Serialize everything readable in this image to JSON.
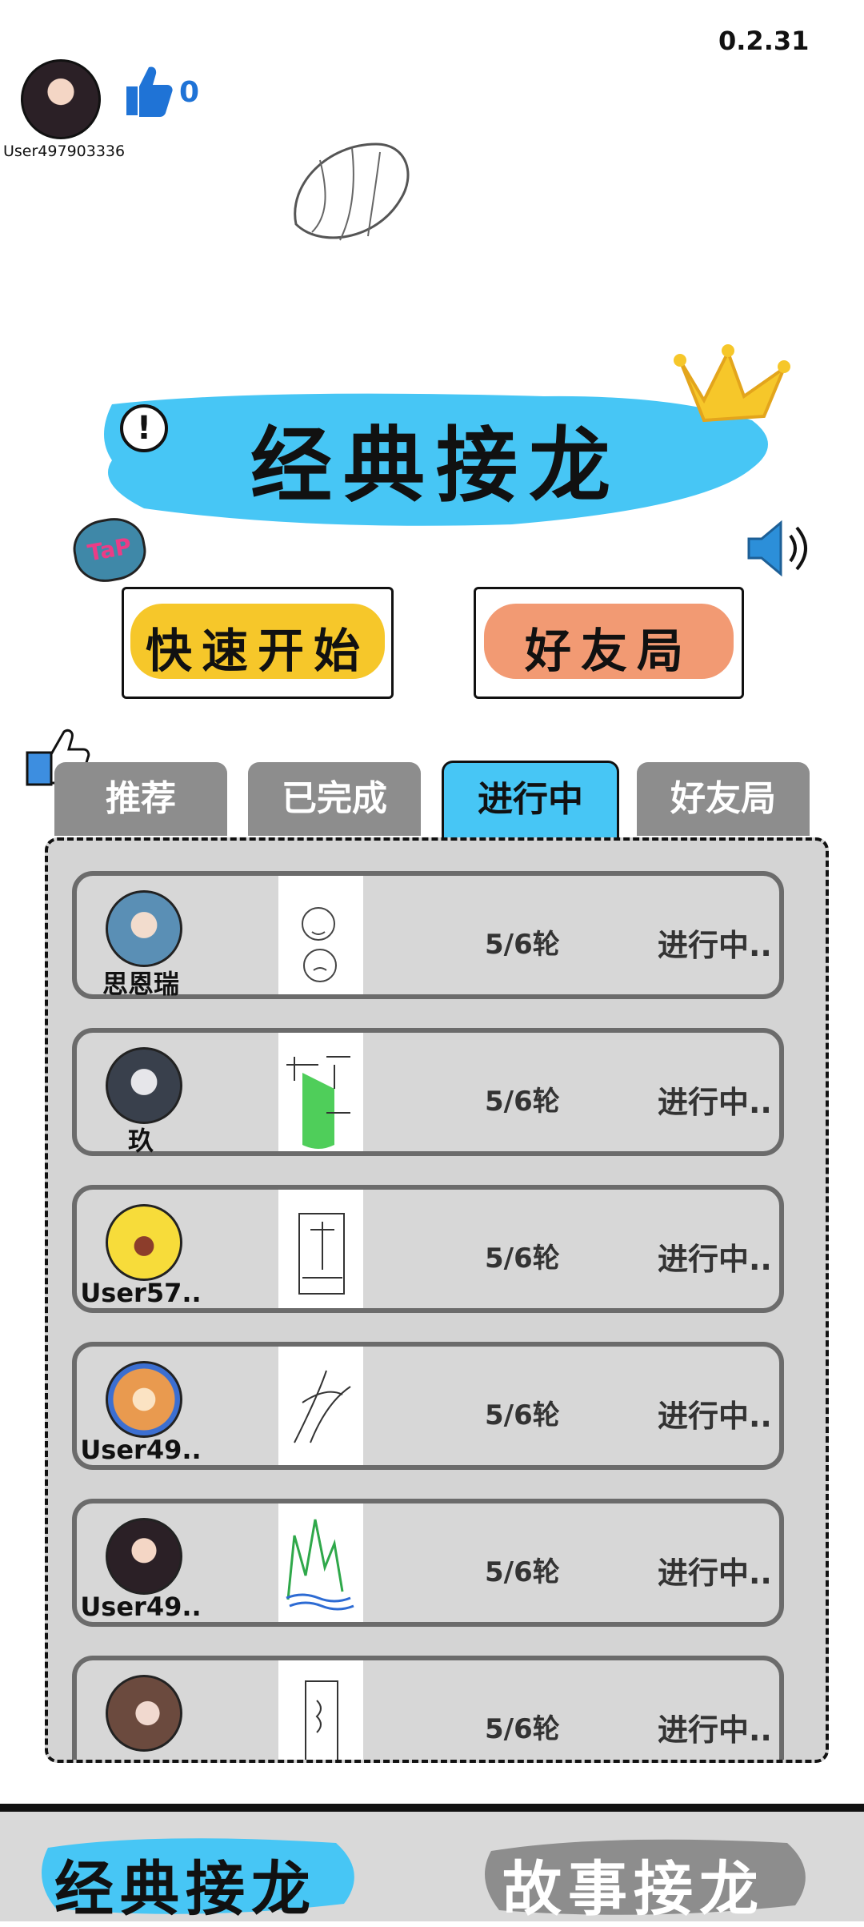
{
  "app": {
    "version": "0.2.31",
    "user": {
      "name": "User497903336",
      "likes": "0"
    },
    "title": "经典接龙",
    "tap_badge": "TaP",
    "buttons": {
      "quick_start": "快速开始",
      "friend_game": "好友局"
    },
    "tabs": [
      "推荐",
      "已完成",
      "进行中",
      "好友局"
    ],
    "active_tab": "进行中",
    "games": [
      {
        "name": "思恩瑞",
        "rounds": "5/6轮",
        "status": "进行中..",
        "avatar_color": "#5a8fb5"
      },
      {
        "name": "玖",
        "rounds": "5/6轮",
        "status": "进行中..",
        "avatar_color": "#39404c"
      },
      {
        "name": "User57..",
        "rounds": "5/6轮",
        "status": "进行中..",
        "avatar_color": "#f7dc3a"
      },
      {
        "name": "User49..",
        "rounds": "5/6轮",
        "status": "进行中..",
        "avatar_color": "#e99a4f"
      },
      {
        "name": "User49..",
        "rounds": "5/6轮",
        "status": "进行中..",
        "avatar_color": "#2b2026"
      },
      {
        "name": "",
        "rounds": "5/6轮",
        "status": "进行中..",
        "avatar_color": "#6b4a3e"
      }
    ],
    "bottom_nav": [
      "经典接龙",
      "故事接龙"
    ],
    "colors": {
      "accent_blue": "#47c6f5",
      "quick_yellow": "#f6c72a",
      "friend_orange": "#f29a73",
      "tab_gray": "#8d8d8d"
    }
  }
}
